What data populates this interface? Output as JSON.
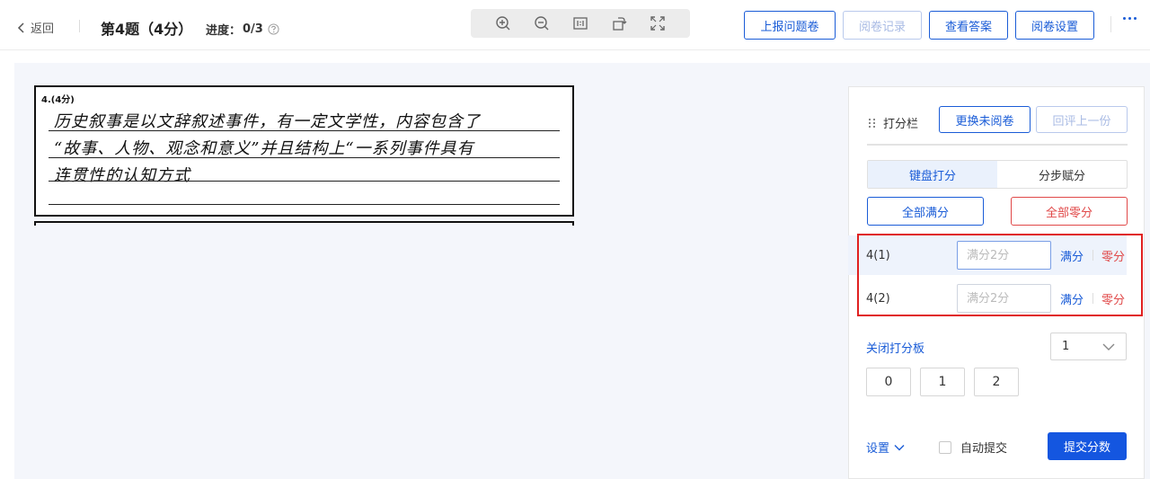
{
  "header": {
    "back_label": "返回",
    "question_title": "第4题（4分）",
    "progress_label": "进度：",
    "progress_value": "0/3",
    "buttons": {
      "report": "上报问题卷",
      "history": "阅卷记录",
      "answer": "查看答案",
      "settings": "阅卷设置"
    },
    "toolbar_icons": [
      "zoom-in-icon",
      "zoom-out-icon",
      "actual-size-icon",
      "rotate-icon",
      "fullscreen-icon"
    ]
  },
  "sheet": {
    "question_label": "4.(4分)",
    "handwriting_lines": [
      "历史叙事是以文辞叙述事件，有一定文学性，内容包含了",
      "“故事、人物、观念和意义”并且结构上“一系列事件具有",
      "连贯性的认知方式"
    ]
  },
  "panel": {
    "title": "打分栏",
    "change_button": "更换未阅卷",
    "back_button": "回评上一份",
    "tabs": [
      {
        "label": "键盘打分",
        "active": true
      },
      {
        "label": "分步赋分",
        "active": false
      }
    ],
    "all_full": "全部满分",
    "all_zero": "全部零分",
    "rows": [
      {
        "label": "4(1)",
        "placeholder": "满分2分",
        "full": "满分",
        "zero": "零分"
      },
      {
        "label": "4(2)",
        "placeholder": "满分2分",
        "full": "满分",
        "zero": "零分"
      }
    ],
    "close_pad": "关闭打分板",
    "step_select": "1",
    "keys": [
      "0",
      "1",
      "2"
    ],
    "settings": "设置",
    "auto_submit": "自动提交",
    "submit": "提交分数"
  },
  "colors": {
    "accent": "#1a5cd7",
    "danger": "#e04848",
    "highlight_box": "#e02020",
    "submit_bg": "#1456e0"
  }
}
